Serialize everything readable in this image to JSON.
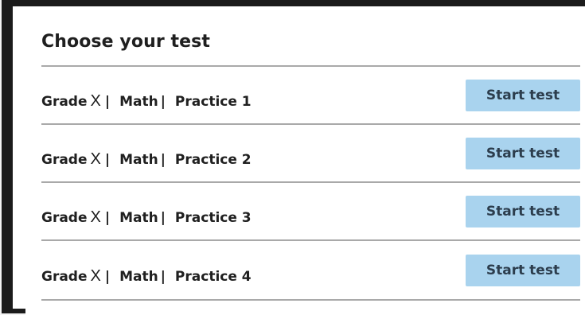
{
  "page": {
    "title": "Choose your test"
  },
  "tests": [
    {
      "grade": "Grade",
      "grade_value": "X",
      "subject": "Math",
      "practice": "Practice 1",
      "separator": "|",
      "button_label": "Start test"
    },
    {
      "grade": "Grade",
      "grade_value": "X",
      "subject": "Math",
      "practice": "Practice 2",
      "separator": "|",
      "button_label": "Start test"
    },
    {
      "grade": "Grade",
      "grade_value": "X",
      "subject": "Math",
      "practice": "Practice 3",
      "separator": "|",
      "button_label": "Start test"
    },
    {
      "grade": "Grade",
      "grade_value": "X",
      "subject": "Math",
      "practice": "Practice 4",
      "separator": "|",
      "button_label": "Start test"
    }
  ],
  "colors": {
    "button_fill": "#a9d3ee",
    "button_text": "#2c3d4d",
    "divider": "#a9a9a9",
    "frame": "#1b1b1b"
  }
}
